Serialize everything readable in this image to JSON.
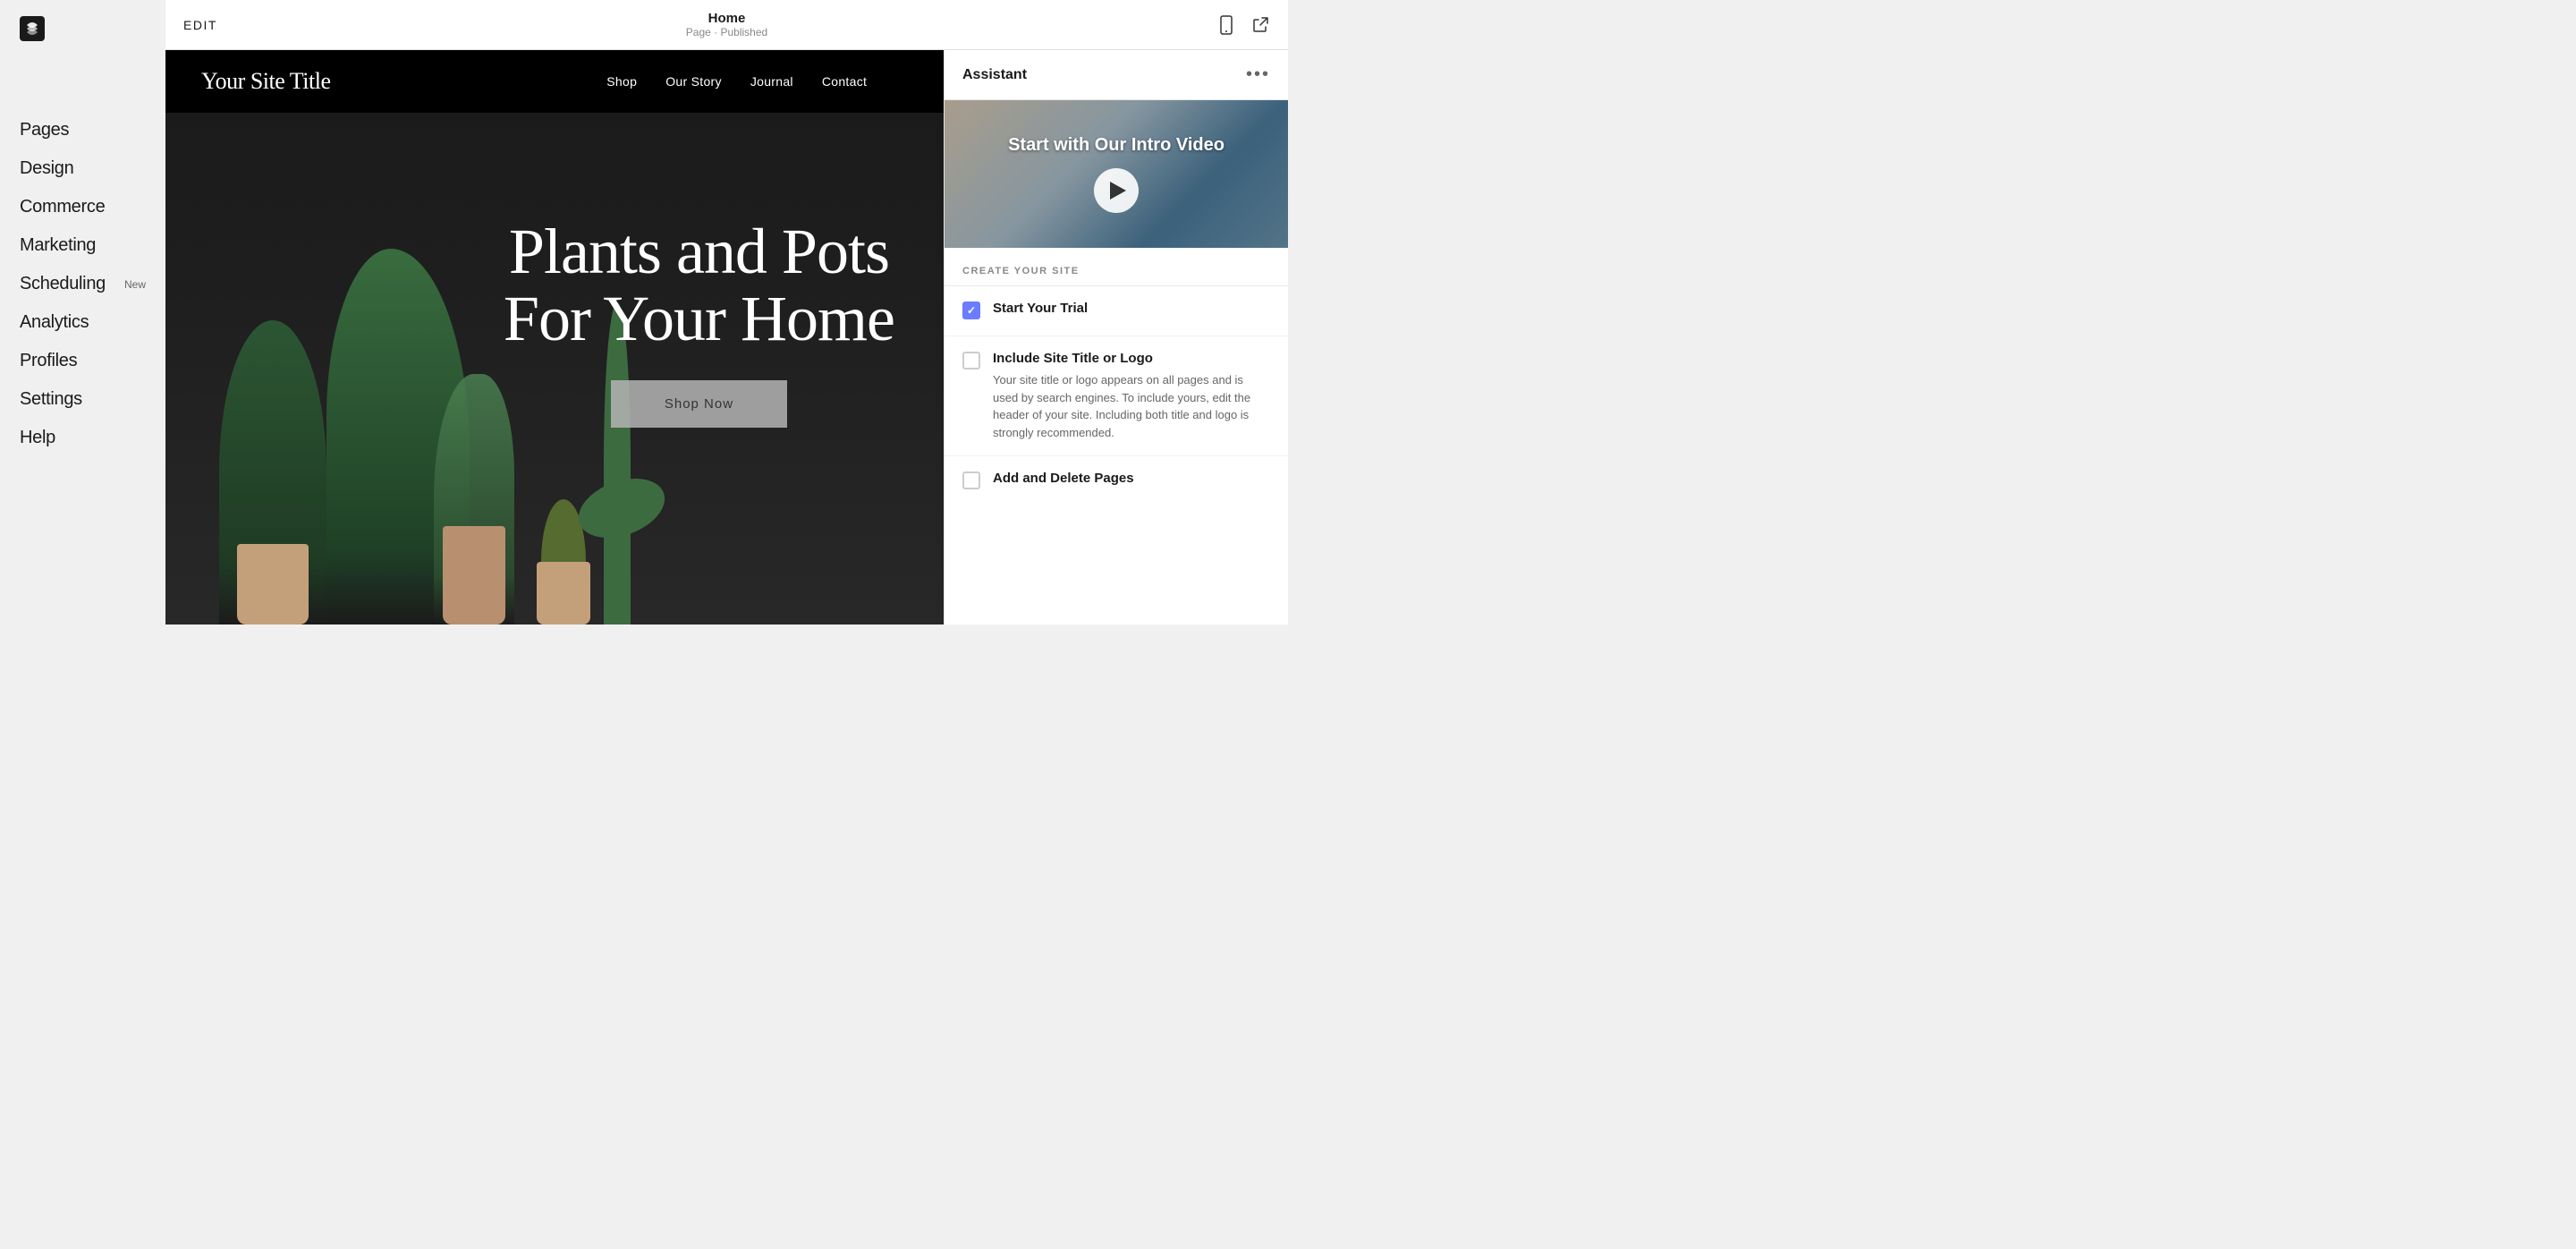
{
  "sidebar": {
    "logo_alt": "Squarespace",
    "nav_items": [
      {
        "id": "pages",
        "label": "Pages",
        "badge": ""
      },
      {
        "id": "design",
        "label": "Design",
        "badge": ""
      },
      {
        "id": "commerce",
        "label": "Commerce",
        "badge": ""
      },
      {
        "id": "marketing",
        "label": "Marketing",
        "badge": ""
      },
      {
        "id": "scheduling",
        "label": "Scheduling",
        "badge": "New"
      },
      {
        "id": "analytics",
        "label": "Analytics",
        "badge": ""
      },
      {
        "id": "profiles",
        "label": "Profiles",
        "badge": ""
      },
      {
        "id": "settings",
        "label": "Settings",
        "badge": ""
      },
      {
        "id": "help",
        "label": "Help",
        "badge": ""
      }
    ]
  },
  "topbar": {
    "edit_label": "EDIT",
    "page_title": "Home",
    "page_status": "Page · Published"
  },
  "site_header": {
    "title": "Your Site Title",
    "nav_items": [
      "Shop",
      "Our Story",
      "Journal",
      "Contact"
    ]
  },
  "hero": {
    "headline_line1": "Plants and Pots",
    "headline_line2": "For Your Home",
    "cta_label": "Shop Now"
  },
  "assistant": {
    "title": "Assistant",
    "menu_label": "•••",
    "video_title": "Start with Our Intro Video",
    "create_site_label": "CREATE YOUR SITE",
    "checklist": [
      {
        "id": "trial",
        "title": "Start Your Trial",
        "description": "",
        "checked": true
      },
      {
        "id": "site-title",
        "title": "Include Site Title or Logo",
        "description": "Your site title or logo appears on all pages and is used by search engines. To include yours, edit the header of your site. Including both title and logo is strongly recommended.",
        "checked": false
      },
      {
        "id": "pages",
        "title": "Add and Delete Pages",
        "description": "",
        "checked": false
      }
    ]
  }
}
